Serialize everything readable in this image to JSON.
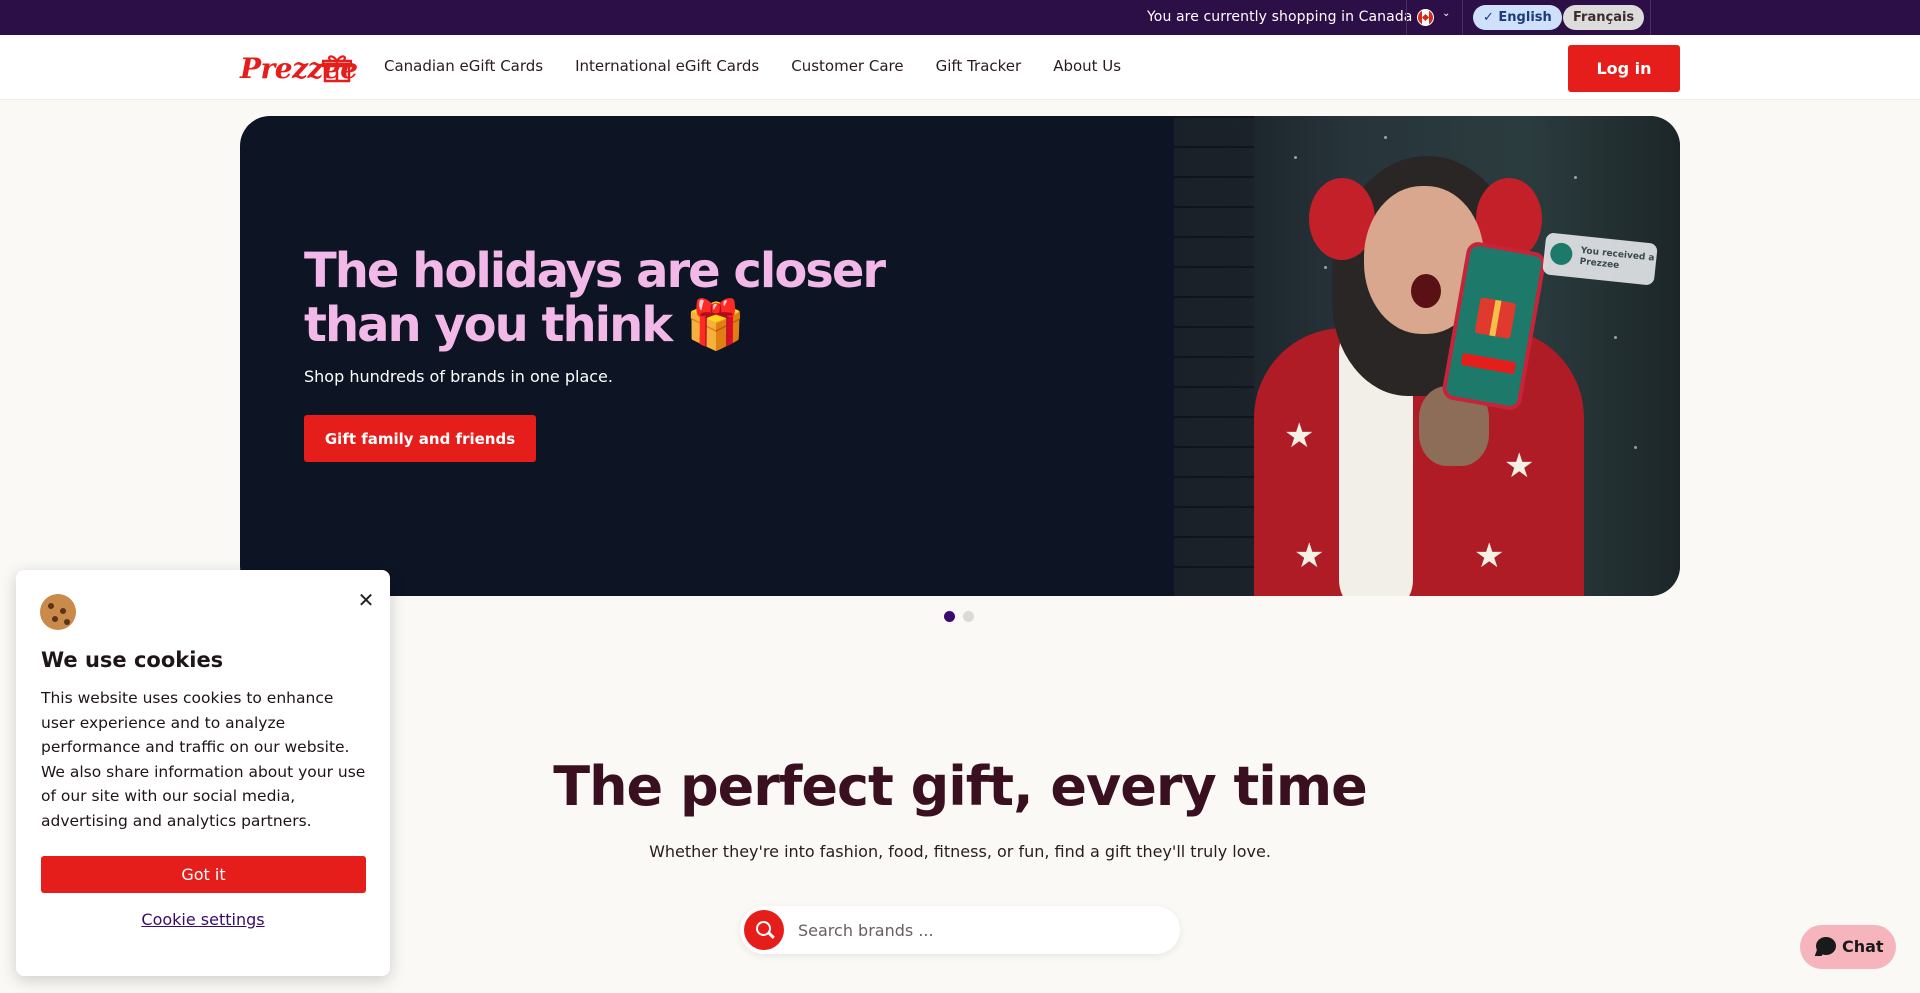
{
  "topbar": {
    "shopping_text": "You are currently shopping in Canada",
    "country_icon": "canada-flag-icon",
    "languages": {
      "english": "English",
      "french": "Français",
      "selected": "English"
    }
  },
  "header": {
    "logo_text": "Prezzee",
    "nav": [
      "Canadian eGift Cards",
      "International eGift Cards",
      "Customer Care",
      "Gift Tracker",
      "About Us"
    ],
    "login_label": "Log in"
  },
  "hero": {
    "title": "The holidays are closer than you think 🎁",
    "subtitle": "Shop hundreds of brands in one place.",
    "cta_label": "Gift family and friends",
    "notification_text": "You received a Prezzee",
    "carousel": {
      "total": 2,
      "active": 1
    }
  },
  "gift_section": {
    "title": "The perfect gift, every time",
    "subtitle": "Whether they're into fashion, food, fitness, or fun, find a gift they'll truly love.",
    "search_placeholder": "Search brands ..."
  },
  "cookie_banner": {
    "title": "We use cookies",
    "body": "This website uses cookies to enhance user experience and to analyze performance and traffic on our website. We also share information about your use of our site with our social media, advertising and analytics partners.",
    "accept_label": "Got it",
    "settings_label": "Cookie settings"
  },
  "chat": {
    "label": "Chat"
  },
  "colors": {
    "brand_red": "#e51e1b",
    "topbar_purple": "#2d0f48",
    "hero_navy": "#0d1424",
    "hero_pink": "#f2b8e7"
  }
}
